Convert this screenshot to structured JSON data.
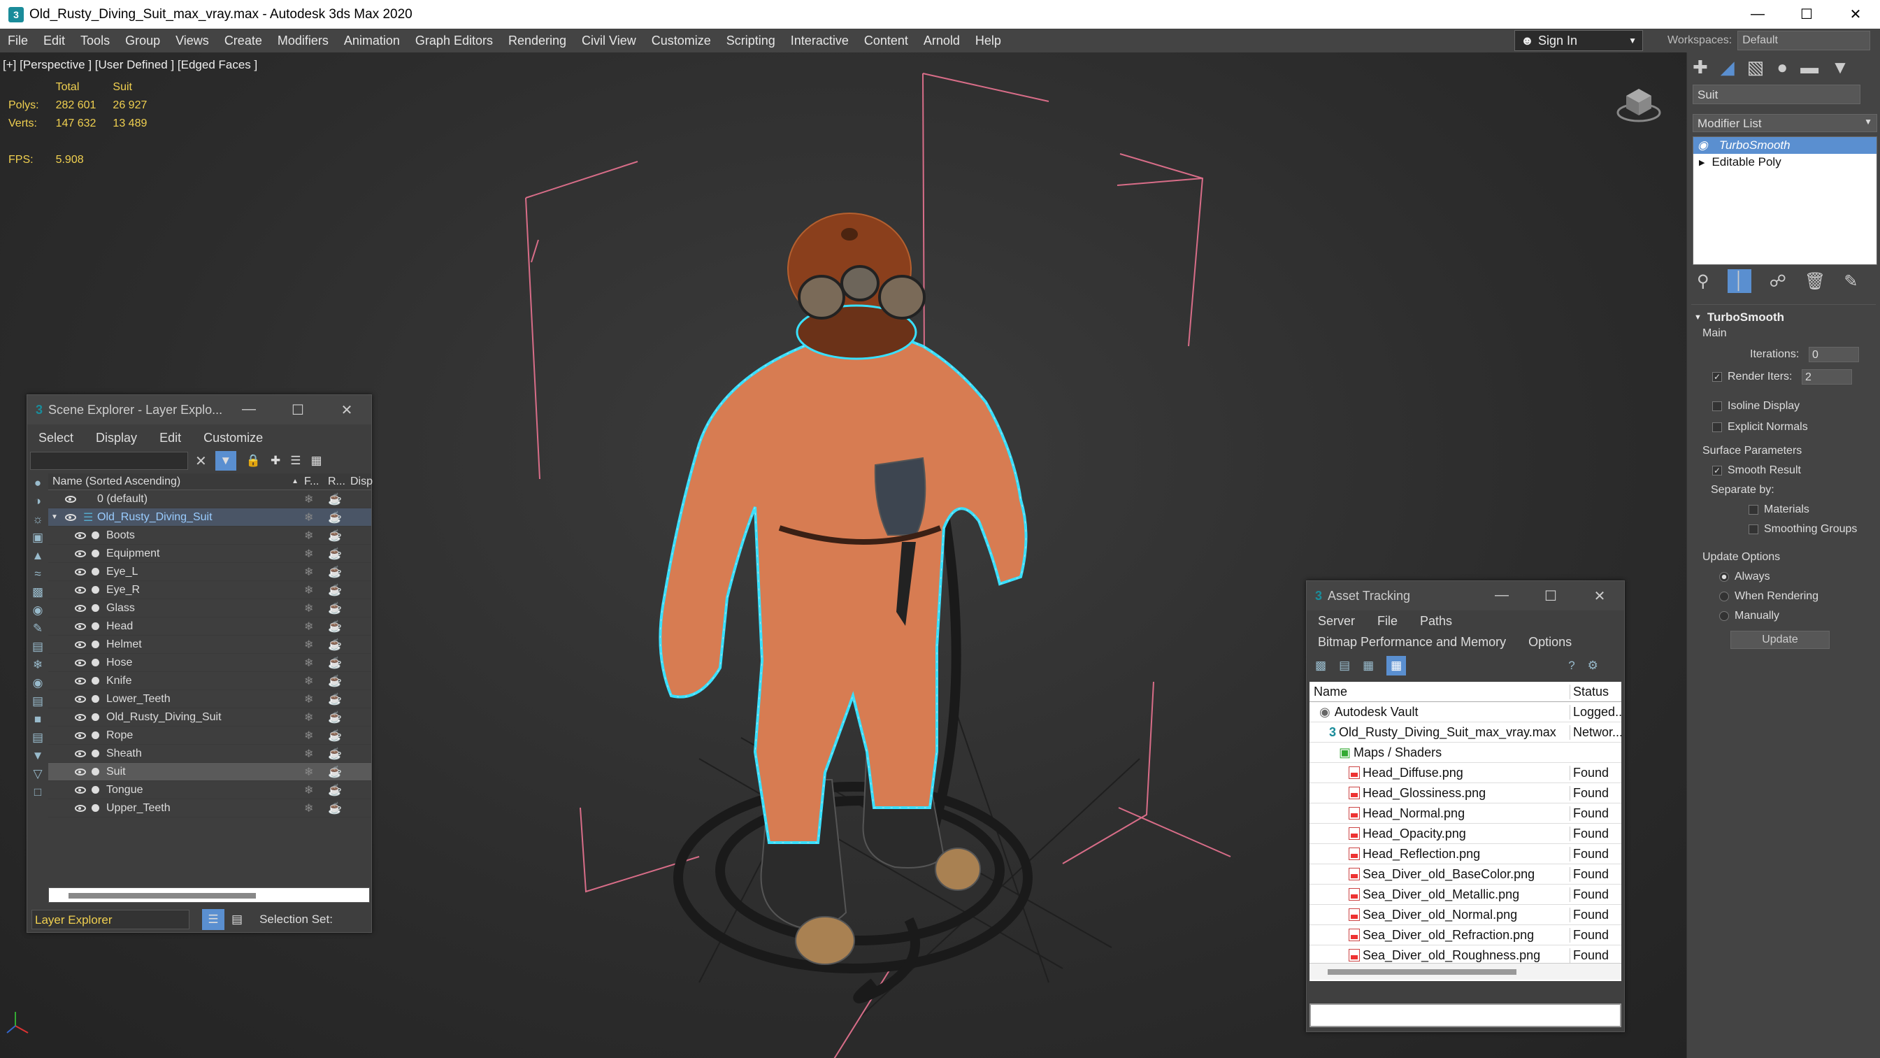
{
  "window": {
    "title": "Old_Rusty_Diving_Suit_max_vray.max - Autodesk 3ds Max 2020",
    "app_icon": "3"
  },
  "menu": [
    "File",
    "Edit",
    "Tools",
    "Group",
    "Views",
    "Create",
    "Modifiers",
    "Animation",
    "Graph Editors",
    "Rendering",
    "Civil View",
    "Customize",
    "Scripting",
    "Interactive",
    "Content",
    "Arnold",
    "Help"
  ],
  "signin": "Sign In",
  "workspaces": {
    "label": "Workspaces:",
    "value": "Default"
  },
  "viewport": {
    "label": "[+] [Perspective ] [User Defined ] [Edged Faces ]",
    "stats": {
      "col1": "Total",
      "col2": "Suit",
      "polys_label": "Polys:",
      "polys_total": "282 601",
      "polys_suit": "26 927",
      "verts_label": "Verts:",
      "verts_total": "147 632",
      "verts_suit": "13 489",
      "fps_label": "FPS:",
      "fps_value": "5.908"
    }
  },
  "scene_explorer": {
    "title": "Scene Explorer - Layer Explo...",
    "menu": [
      "Select",
      "Display",
      "Edit",
      "Customize"
    ],
    "col_name": "Name (Sorted Ascending)",
    "col_f": "F...",
    "col_r": "R...",
    "col_d": "Disp",
    "rows": [
      {
        "label": "0 (default)",
        "level": 0
      },
      {
        "label": "Old_Rusty_Diving_Suit",
        "level": 0
      },
      {
        "label": "Boots",
        "level": 1
      },
      {
        "label": "Equipment",
        "level": 1
      },
      {
        "label": "Eye_L",
        "level": 1
      },
      {
        "label": "Eye_R",
        "level": 1
      },
      {
        "label": "Glass",
        "level": 1
      },
      {
        "label": "Head",
        "level": 1
      },
      {
        "label": "Helmet",
        "level": 1
      },
      {
        "label": "Hose",
        "level": 1
      },
      {
        "label": "Knife",
        "level": 1
      },
      {
        "label": "Lower_Teeth",
        "level": 1
      },
      {
        "label": "Old_Rusty_Diving_Suit",
        "level": 1
      },
      {
        "label": "Rope",
        "level": 1
      },
      {
        "label": "Sheath",
        "level": 1
      },
      {
        "label": "Suit",
        "level": 1
      },
      {
        "label": "Tongue",
        "level": 1
      },
      {
        "label": "Upper_Teeth",
        "level": 1
      }
    ],
    "footer_mode": "Layer Explorer",
    "selection_set": "Selection Set:"
  },
  "asset_tracking": {
    "title": "Asset Tracking",
    "menu1": [
      "Server",
      "File",
      "Paths"
    ],
    "menu2": [
      "Bitmap Performance and Memory",
      "Options"
    ],
    "col_name": "Name",
    "col_status": "Status",
    "rows": [
      {
        "name": "Autodesk Vault",
        "status": "Logged...",
        "indent": 1,
        "icon": "vault"
      },
      {
        "name": "Old_Rusty_Diving_Suit_max_vray.max",
        "status": "Networ...",
        "indent": 2,
        "icon": "max"
      },
      {
        "name": "Maps / Shaders",
        "status": "",
        "indent": 3,
        "icon": "maps"
      },
      {
        "name": "Head_Diffuse.png",
        "status": "Found",
        "indent": 4,
        "icon": "file"
      },
      {
        "name": "Head_Glossiness.png",
        "status": "Found",
        "indent": 4,
        "icon": "file"
      },
      {
        "name": "Head_Normal.png",
        "status": "Found",
        "indent": 4,
        "icon": "file"
      },
      {
        "name": "Head_Opacity.png",
        "status": "Found",
        "indent": 4,
        "icon": "file"
      },
      {
        "name": "Head_Reflection.png",
        "status": "Found",
        "indent": 4,
        "icon": "file"
      },
      {
        "name": "Sea_Diver_old_BaseColor.png",
        "status": "Found",
        "indent": 4,
        "icon": "file"
      },
      {
        "name": "Sea_Diver_old_Metallic.png",
        "status": "Found",
        "indent": 4,
        "icon": "file"
      },
      {
        "name": "Sea_Diver_old_Normal.png",
        "status": "Found",
        "indent": 4,
        "icon": "file"
      },
      {
        "name": "Sea_Diver_old_Refraction.png",
        "status": "Found",
        "indent": 4,
        "icon": "file"
      },
      {
        "name": "Sea_Diver_old_Roughness.png",
        "status": "Found",
        "indent": 4,
        "icon": "file"
      }
    ]
  },
  "command_panel": {
    "object_name": "Suit",
    "modifier_list": "Modifier List",
    "stack": [
      "TurboSmooth",
      "Editable Poly"
    ],
    "rollout_title": "TurboSmooth",
    "main_label": "Main",
    "iterations_label": "Iterations:",
    "iterations_value": "0",
    "render_iters_label": "Render Iters:",
    "render_iters_value": "2",
    "isoline": "Isoline Display",
    "explicit_normals": "Explicit Normals",
    "surface_params": "Surface Parameters",
    "smooth_result": "Smooth Result",
    "separate_by": "Separate by:",
    "materials": "Materials",
    "smoothing_groups": "Smoothing Groups",
    "update_options": "Update Options",
    "always": "Always",
    "when_rendering": "When Rendering",
    "manually": "Manually",
    "update_button": "Update"
  },
  "colors": {
    "accent": "#5a8fd0",
    "selection_cyan": "#39e0ff",
    "stats_yellow": "#f0d050"
  }
}
